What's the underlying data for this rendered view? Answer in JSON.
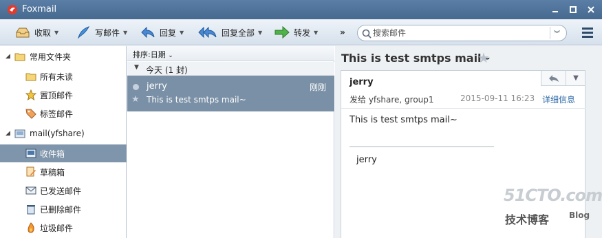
{
  "app": {
    "title": "Foxmail"
  },
  "colors": {
    "titlebar": "#4e7399",
    "selection": "#7a90a6",
    "link": "#2d6aa8"
  },
  "toolbar": {
    "receive": "收取",
    "compose": "写邮件",
    "reply": "回复",
    "reply_all": "回复全部",
    "forward": "转发",
    "more": "»"
  },
  "search": {
    "placeholder": "搜索邮件"
  },
  "sidebar": {
    "favorites": {
      "label": "常用文件夹",
      "items": [
        {
          "label": "所有未读",
          "icon": "folder-icon"
        },
        {
          "label": "置顶邮件",
          "icon": "star-icon"
        },
        {
          "label": "标签邮件",
          "icon": "tag-icon"
        }
      ]
    },
    "account": {
      "label": "mail(yfshare)",
      "items": [
        {
          "label": "收件箱",
          "icon": "inbox-icon",
          "selected": true
        },
        {
          "label": "草稿箱",
          "icon": "drafts-icon"
        },
        {
          "label": "已发送邮件",
          "icon": "sent-icon"
        },
        {
          "label": "已删除邮件",
          "icon": "trash-icon"
        },
        {
          "label": "垃圾邮件",
          "icon": "junk-icon"
        }
      ]
    }
  },
  "list": {
    "sort_label": "排序:日期",
    "group_label": "今天 (1 封)",
    "messages": [
      {
        "sender": "jerry",
        "time": "刚刚",
        "subject": "This is test smtps mail~"
      }
    ]
  },
  "reader": {
    "subject": "This is test smtps mail~",
    "from": "jerry",
    "to": "发给 yfshare, group1",
    "date": "2015-09-11 16:23",
    "details": "详细信息",
    "body": "This is test smtps mail~",
    "signature": "jerry"
  },
  "watermark": {
    "line1": "51CTO.com",
    "line2": "技术博客",
    "line3": "Blog"
  }
}
